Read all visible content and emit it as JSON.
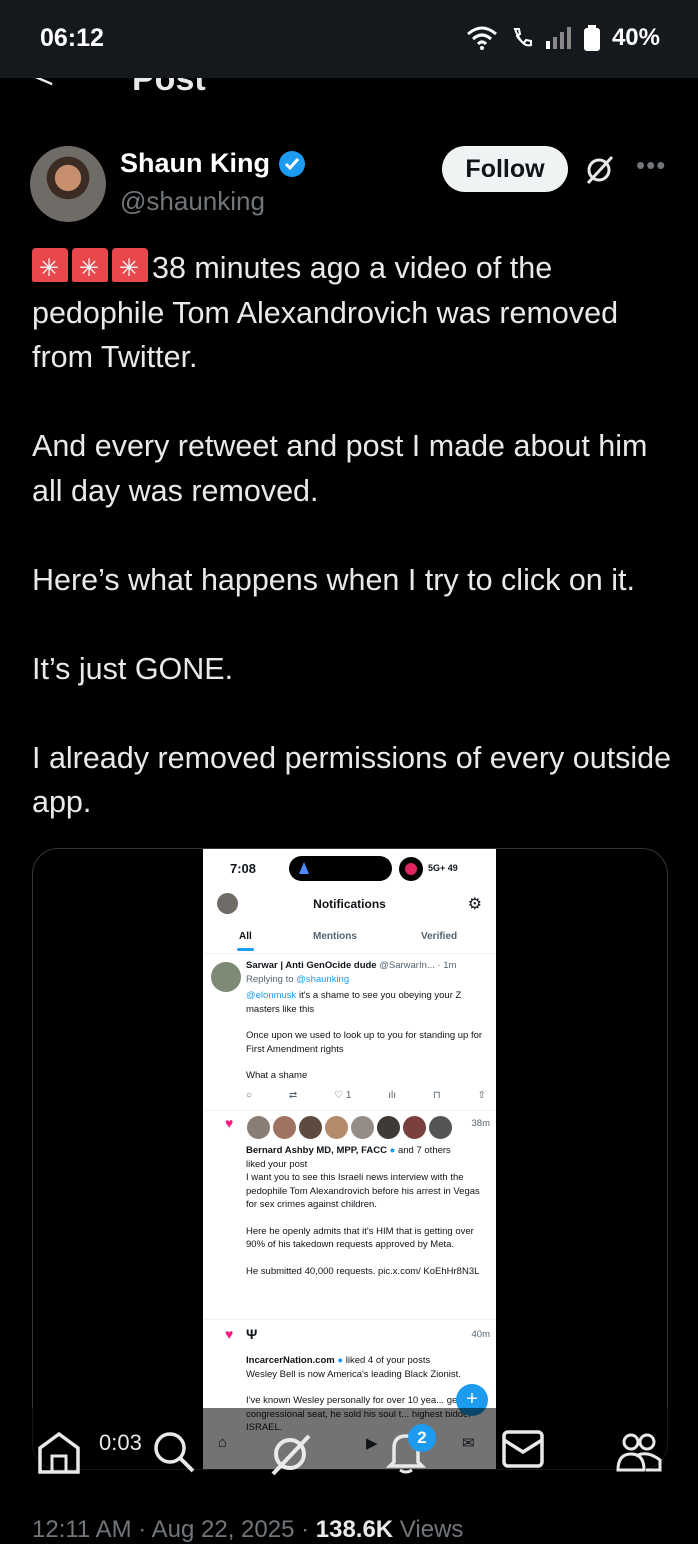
{
  "status_bar": {
    "time": "06:12",
    "battery": "40%"
  },
  "topbar": {
    "back": "<",
    "title": "Post"
  },
  "author": {
    "name": "Shaun King",
    "handle": "@shaunking"
  },
  "actions": {
    "follow": "Follow"
  },
  "post": {
    "lines": [
      "38 minutes ago a video of the pedophile Tom Alexandrovich was removed from Twitter.",
      "And every retweet and post I made about him all day was removed.",
      "Here’s what happens when I try to click on it.",
      "It’s just GONE.",
      "I already removed permissions of every outside app."
    ]
  },
  "embedded": {
    "time": "7:08",
    "network": "5G+",
    "battery": "49",
    "title": "Notifications",
    "tabs": [
      "All",
      "Mentions",
      "Verified"
    ],
    "reply": {
      "name": "Sarwar | Anti GenOcide dude",
      "handle": "@SarwarIn...",
      "age": "1m",
      "replying_prefix": "Replying to ",
      "replying_handle": "@shaunking",
      "mention": "@elonmusk",
      "text1": " it's a shame to see you obeying your Z masters like this",
      "text2": "Once upon we used to look up to you for standing up for First Amendment rights",
      "text3": "What a shame",
      "likes": "1"
    },
    "likes_notice": {
      "age": "38m",
      "name": "Bernard Ashby MD, MPP, FACC",
      "suffix": " and 7 others",
      "action": "liked your post",
      "text1": "I want you to see this Israeli news interview with the pedophile Tom Alexandrovich before his arrest in Vegas for sex crimes against children.",
      "text2": "Here he openly admits that it's HIM that is getting over 90% of his takedown requests approved by Meta.",
      "text3": "He submitted 40,000 requests. pic.x.com/ KoEhHr8N3L"
    },
    "incarcer": {
      "age": "40m",
      "name": "IncarcerNation.com",
      "action": " liked 4 of your posts",
      "text1": "Wesley Bell is now America's leading Black Zionist.",
      "text2": "I've known Wesley personally for over 10 yea... get his congressional seat, he sold his soul t... highest bidder - ISRAEL."
    },
    "badge": "2"
  },
  "video": {
    "timer": "0:03"
  },
  "meta": {
    "time": "12:11 AM · Aug 22, 2025 · ",
    "views_count": "138.6K",
    "views_label": " Views"
  }
}
